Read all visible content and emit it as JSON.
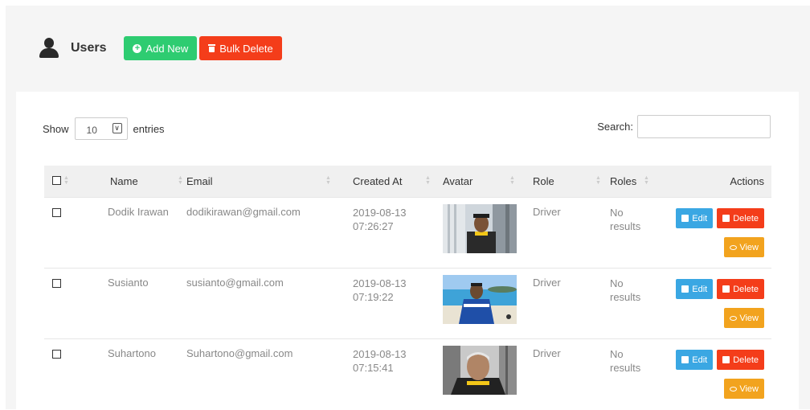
{
  "header": {
    "title": "Users",
    "add_new_label": "Add New",
    "bulk_delete_label": "Bulk Delete",
    "colors": {
      "add_new": "#2ecc71",
      "bulk_delete": "#f43d1a"
    }
  },
  "table_controls": {
    "show_label": "Show",
    "entries_value": "10",
    "entries_label": "entries",
    "search_label": "Search:",
    "search_value": ""
  },
  "columns": [
    "",
    "Name",
    "Email",
    "Created At",
    "Avatar",
    "Role",
    "Roles",
    "Actions"
  ],
  "rows": [
    {
      "name": "Dodik Irawan",
      "email": "dodikirawan@gmail.com",
      "created_date": "2019-08-13",
      "created_time": "07:26:27",
      "role": "Driver",
      "roles_1": "No",
      "roles_2": "results"
    },
    {
      "name": "Susianto",
      "email": "susianto@gmail.com",
      "created_date": "2019-08-13",
      "created_time": "07:19:22",
      "role": "Driver",
      "roles_1": "No",
      "roles_2": "results"
    },
    {
      "name": "Suhartono",
      "email": "Suhartono@gmail.com",
      "created_date": "2019-08-13",
      "created_time": "07:15:41",
      "role": "Driver",
      "roles_1": "No",
      "roles_2": "results"
    }
  ],
  "actions": {
    "edit": "Edit",
    "delete": "Delete",
    "view": "View",
    "colors": {
      "edit": "#3aa7e3",
      "delete": "#f43d1a",
      "view": "#f2a31e"
    }
  },
  "icons": {
    "user": "user-icon",
    "add": "plus-circle-icon",
    "trash": "trash-icon",
    "edit": "edit-icon",
    "view": "eye-icon",
    "sort": "sort-icon"
  }
}
